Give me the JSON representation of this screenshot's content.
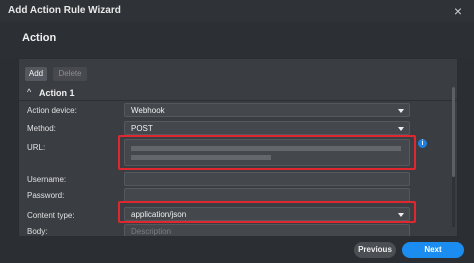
{
  "window": {
    "title": "Add Action Rule Wizard",
    "close_icon": "×"
  },
  "header": {
    "section_title": "Action"
  },
  "toolbar": {
    "add_label": "Add",
    "delete_label": "Delete"
  },
  "action": {
    "title": "Action 1",
    "fields": {
      "action_device": {
        "label": "Action device:",
        "value": "Webhook"
      },
      "method": {
        "label": "Method:",
        "value": "POST"
      },
      "url": {
        "label": "URL:",
        "value": ""
      },
      "username": {
        "label": "Username:",
        "value": ""
      },
      "password": {
        "label": "Password:",
        "value": ""
      },
      "content_type": {
        "label": "Content type:",
        "value": "application/json"
      },
      "body": {
        "label": "Body:",
        "placeholder": "Description"
      }
    }
  },
  "footer": {
    "previous_label": "Previous",
    "next_label": "Next"
  },
  "colors": {
    "accent": "#1b8cf0",
    "highlight": "#e0262e"
  }
}
